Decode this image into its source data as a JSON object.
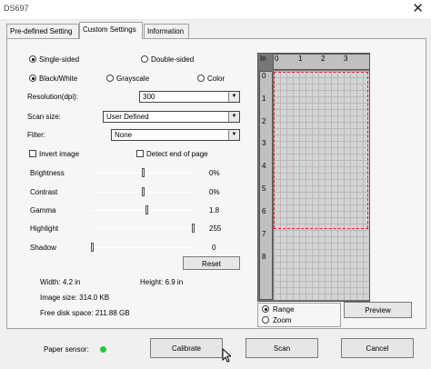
{
  "window": {
    "title": "DS697",
    "close_glyph": "✕"
  },
  "tabs": [
    {
      "label": "Pre-defined Setting"
    },
    {
      "label": "Custom Settings"
    },
    {
      "label": "Information"
    }
  ],
  "scan_side": {
    "single": "Single-sided",
    "double": "Double-sided",
    "selected": "Single-sided"
  },
  "color_mode": {
    "bw": "Black/White",
    "gray": "Grayscale",
    "color": "Color",
    "selected": "Black/White"
  },
  "resolution": {
    "label": "Resolution(dpi):",
    "value": "300"
  },
  "scan_size": {
    "label": "Scan size:",
    "value": "User Defined"
  },
  "filter": {
    "label": "Filter:",
    "value": "None"
  },
  "invert_image": {
    "label": "Invert image",
    "checked": false
  },
  "detect_end": {
    "label": "Detect end of page",
    "checked": false
  },
  "sliders": [
    {
      "label": "Brightness",
      "value": "0%",
      "level": 0.5
    },
    {
      "label": "Contrast",
      "value": "0%",
      "level": 0.5
    },
    {
      "label": "Gamma",
      "value": "1.8",
      "level": 0.54
    },
    {
      "label": "Highlight",
      "value": "255",
      "level": 1.0
    },
    {
      "label": "Shadow",
      "value": "0",
      "level": 0.0
    }
  ],
  "reset_button": "Reset",
  "info": {
    "width": "Width: 4.2 in",
    "height": "Height: 6.9 in",
    "image_size": "Image size: 314.0 KB",
    "free_disk": "Free disk space: 211.88 GB"
  },
  "preview": {
    "ruler_unit": "In",
    "h_ticks": [
      "0",
      "1",
      "2",
      "3"
    ],
    "v_ticks": [
      "0",
      "1",
      "2",
      "3",
      "4",
      "5",
      "6",
      "7",
      "8"
    ],
    "range_label": "Range",
    "zoom_label": "Zoom",
    "mode_selected": "Range",
    "preview_button": "Preview"
  },
  "paper_sensor": {
    "label": "Paper sensor:",
    "status_color": "#22cc33"
  },
  "buttons": {
    "calibrate": "Calibrate",
    "scan": "Scan",
    "cancel": "Cancel"
  },
  "colors": {
    "selection": "#e02020",
    "panel": "#f6f6f6"
  }
}
